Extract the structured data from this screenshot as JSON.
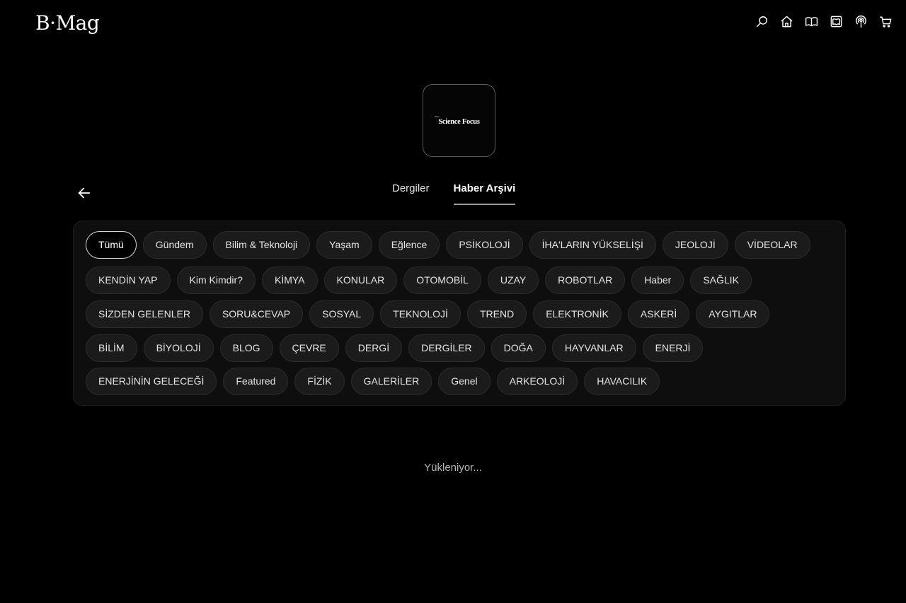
{
  "header": {
    "logo": "B·Mag",
    "icons": [
      "search-icon",
      "home-icon",
      "book-open-icon",
      "magazine-icon",
      "podcast-icon",
      "cart-icon"
    ]
  },
  "brand": {
    "small_text": "BBC",
    "name": "Science Focus"
  },
  "tabs": [
    {
      "label": "Dergiler",
      "active": false
    },
    {
      "label": "Haber Arşivi",
      "active": true
    }
  ],
  "categories": {
    "row1": [
      "Tümü",
      "Gündem",
      "Bilim & Teknoloji",
      "Yaşam",
      "Eğlence",
      "PSİKOLOJİ",
      "İHA'LARIN YÜKSELİŞİ",
      "JEOLOJİ",
      "VİDEOLAR"
    ],
    "row2": [
      "KENDİN YAP",
      "Kim Kimdir?",
      "KİMYA",
      "KONULAR",
      "OTOMOBİL",
      "UZAY",
      "ROBOTLAR",
      "Haber",
      "SAĞLIK"
    ],
    "row3": [
      "SİZDEN GELENLER",
      "SORU&CEVAP",
      "SOSYAL",
      "TEKNOLOJİ",
      "TREND",
      "ELEKTRONİK",
      "ASKERİ",
      "AYGITLAR"
    ],
    "row4": [
      "BİLİM",
      "BİYOLOJİ",
      "BLOG",
      "ÇEVRE",
      "DERGİ",
      "DERGİLER",
      "DOĞA",
      "HAYVANLAR",
      "ENERJİ"
    ],
    "row5": [
      "ENERJİNİN GELECEĞİ",
      "Featured",
      "FİZİK",
      "GALERİLER",
      "Genel",
      "ARKEOLOJİ",
      "HAVACILIK"
    ],
    "selected": "Tümü"
  },
  "status": {
    "loading_text": "Yükleniyor..."
  },
  "colors": {
    "background": "#000000",
    "chip_bg": "#1b1b1b",
    "panel_bg": "#0e0e0e",
    "text": "#ffffff"
  }
}
